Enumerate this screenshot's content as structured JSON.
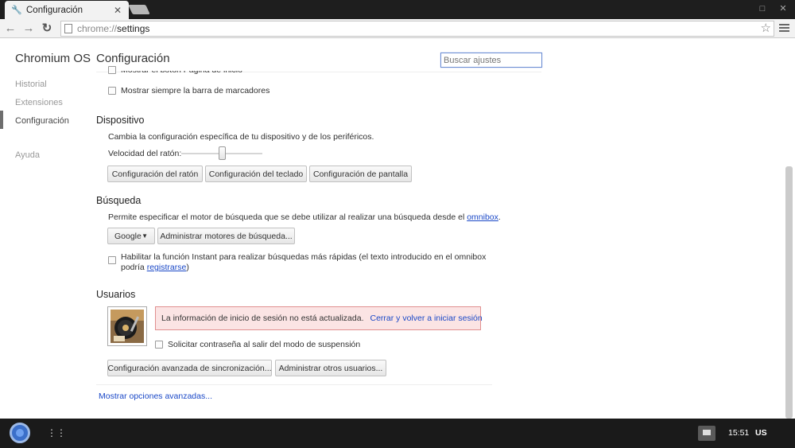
{
  "tab": {
    "title": "Configuración",
    "close": "✕"
  },
  "toolbar": {
    "back": "←",
    "forward": "→",
    "reload": "↻",
    "url_scheme": "chrome://",
    "url_host": "settings",
    "star": "☆"
  },
  "window": {
    "restore": "□",
    "close": "✕"
  },
  "sidebar": {
    "title": "Chromium OS",
    "items": [
      {
        "label": "Historial"
      },
      {
        "label": "Extensiones"
      },
      {
        "label": "Configuración"
      },
      {
        "label": "Ayuda"
      }
    ]
  },
  "page": {
    "title": "Configuración",
    "search_placeholder": "Buscar ajustes"
  },
  "appearance": {
    "home_button": "Mostrar el botón Página de inicio",
    "bookmarks_bar": "Mostrar siempre la barra de marcadores"
  },
  "device": {
    "title": "Dispositivo",
    "description": "Cambia la configuración específica de tu dispositivo y de los periféricos.",
    "mouse_speed_label": "Velocidad del ratón:",
    "mouse_speed_fraction": 0.5,
    "buttons": [
      "Configuración del ratón",
      "Configuración del teclado",
      "Configuración de pantalla"
    ]
  },
  "search": {
    "title": "Búsqueda",
    "description": "Permite especificar el motor de búsqueda que se debe utilizar al realizar una búsqueda desde el",
    "omnibox_link": "omnibox",
    "period": ".",
    "engine": "Google",
    "dropdown_arrow": "▼",
    "manage_button": "Administrar motores de búsqueda...",
    "instant_line1": "Habilitar la función Instant para realizar búsquedas más rápidas (el texto introducido en el omnibox",
    "instant_line2_prefix": "podría ",
    "instant_link": "registrarse",
    "instant_suffix": ")"
  },
  "users": {
    "title": "Usuarios",
    "alert_text": "La información de inicio de sesión no está actualizada.",
    "alert_link": "Cerrar y volver a iniciar sesión",
    "password_checkbox": "Solicitar contraseña al salir del modo de suspensión",
    "sync_button": "Configuración avanzada de sincronización...",
    "manage_users_button": "Administrar otros usuarios..."
  },
  "advanced_link": "Mostrar opciones avanzadas...",
  "shelf": {
    "time": "15:51",
    "ime": "US"
  },
  "colors": {
    "accent_link": "#1a48c7",
    "alert_bg": "#fbe4e4",
    "arrow": "#f26b73"
  }
}
